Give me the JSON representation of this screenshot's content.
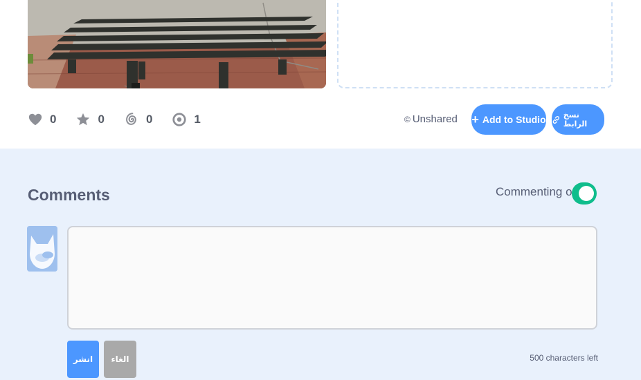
{
  "stats": {
    "loves": "0",
    "favorites": "0",
    "remixes": "0",
    "views": "1"
  },
  "share": {
    "status_icon": "©",
    "status_label": "Unshared",
    "add_to_studio_label": "Add to Studio",
    "copy_link_label": "نسخ الرابط"
  },
  "comments": {
    "title": "Comments",
    "commenting_label": "Commenting on",
    "commenting_enabled": true,
    "input_value": "",
    "post_label": "انشر",
    "cancel_label": "الغاء",
    "chars_left": "500 characters left"
  },
  "colors": {
    "accent_blue": "#4c97ff",
    "toggle_green": "#0fbd8c",
    "comments_bg": "#e9f1fc",
    "text": "#575e75"
  },
  "icons": [
    "heart-icon",
    "star-icon",
    "remix-spiral-icon",
    "eye-icon",
    "copyright-icon",
    "plus-icon",
    "link-icon"
  ]
}
